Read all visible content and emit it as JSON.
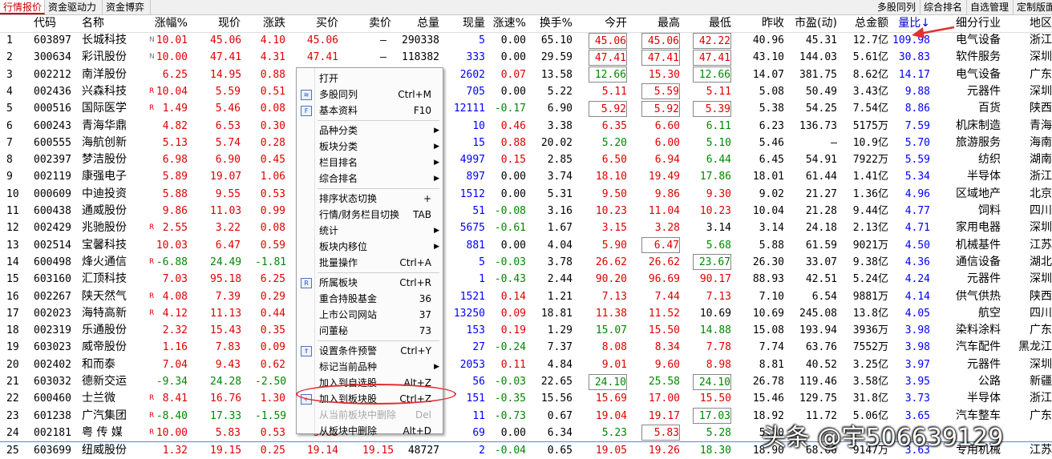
{
  "tabs_left": [
    "行情报价",
    "资金驱动力",
    "资金博弈"
  ],
  "tabs_right": [
    "多股同列",
    "综合排名",
    "自选管理",
    "定制版面"
  ],
  "headers": [
    "代码",
    "名称",
    "涨幅%",
    "现价",
    "涨跌",
    "买价",
    "卖价",
    "总量",
    "现量",
    "涨速%",
    "换手%",
    "今开",
    "最高",
    "最低",
    "昨收",
    "市盈(动)",
    "总金额",
    "量比↓",
    "细分行业",
    "地区"
  ],
  "rows": [
    [
      "1",
      "603897",
      "长城科技",
      "N",
      "10.01",
      "45.06",
      "4.10",
      "45.06",
      "—",
      "290338",
      "5",
      "0.00",
      "65.10",
      "45.06",
      "45.06",
      "42.22",
      "40.96",
      "45.31",
      "12.7亿",
      "109.98",
      "电气设备",
      "浙江"
    ],
    [
      "2",
      "300634",
      "彩讯股份",
      "N",
      "10.00",
      "47.41",
      "4.31",
      "47.41",
      "—",
      "118382",
      "333",
      "0.00",
      "29.59",
      "47.41",
      "47.41",
      "47.41",
      "43.10",
      "144.03",
      "5.61亿",
      "30.83",
      "软件服务",
      "深圳"
    ],
    [
      "3",
      "002212",
      "南洋股份",
      "",
      "6.25",
      "14.95",
      "0.88",
      "",
      "",
      "",
      "2602",
      "0.07",
      "13.58",
      "12.66",
      "15.30",
      "12.66",
      "14.07",
      "381.75",
      "8.62亿",
      "14.17",
      "电气设备",
      "广东"
    ],
    [
      "4",
      "002436",
      "兴森科技",
      "R",
      "10.04",
      "5.59",
      "0.51",
      "",
      "",
      "",
      "705",
      "0.00",
      "5.22",
      "5.11",
      "5.59",
      "5.11",
      "5.08",
      "50.49",
      "3.43亿",
      "9.88",
      "元器件",
      "深圳"
    ],
    [
      "5",
      "000516",
      "国际医学",
      "R",
      "1.49",
      "5.46",
      "0.08",
      "",
      "",
      "",
      "12111",
      "-0.17",
      "6.90",
      "5.92",
      "5.92",
      "5.39",
      "5.38",
      "54.25",
      "7.54亿",
      "8.86",
      "百货",
      "陕西"
    ],
    [
      "6",
      "600243",
      "青海华鼎",
      "",
      "4.82",
      "6.53",
      "0.30",
      "",
      "",
      "",
      "10",
      "0.46",
      "3.38",
      "6.35",
      "6.60",
      "6.11",
      "6.23",
      "136.73",
      "5175万",
      "7.59",
      "机床制造",
      "青海"
    ],
    [
      "7",
      "600555",
      "海航创新",
      "",
      "5.13",
      "5.74",
      "0.28",
      "",
      "",
      "",
      "15",
      "0.88",
      "20.02",
      "5.20",
      "6.00",
      "5.10",
      "5.46",
      "—",
      "10.9亿",
      "5.70",
      "旅游服务",
      "海南"
    ],
    [
      "8",
      "002397",
      "梦洁股份",
      "",
      "6.98",
      "6.90",
      "0.45",
      "",
      "",
      "",
      "4997",
      "0.15",
      "2.85",
      "6.50",
      "6.94",
      "6.44",
      "6.45",
      "54.91",
      "7922万",
      "5.59",
      "纺织",
      "湖南"
    ],
    [
      "9",
      "002119",
      "康强电子",
      "",
      "5.89",
      "19.07",
      "1.06",
      "",
      "",
      "",
      "897",
      "0.00",
      "3.74",
      "18.10",
      "19.49",
      "17.86",
      "18.01",
      "61.44",
      "1.41亿",
      "5.34",
      "半导体",
      "浙江"
    ],
    [
      "10",
      "000609",
      "中迪投资",
      "",
      "5.88",
      "9.55",
      "0.53",
      "",
      "",
      "",
      "1512",
      "0.00",
      "5.31",
      "9.50",
      "9.86",
      "9.30",
      "9.02",
      "21.27",
      "1.36亿",
      "4.96",
      "区域地产",
      "北京"
    ],
    [
      "11",
      "600438",
      "通威股份",
      "",
      "9.86",
      "11.03",
      "0.99",
      "",
      "",
      "",
      "51",
      "-0.08",
      "3.16",
      "10.23",
      "11.04",
      "10.23",
      "10.04",
      "21.28",
      "9.44亿",
      "4.77",
      "饲料",
      "四川"
    ],
    [
      "12",
      "002429",
      "兆驰股份",
      "R",
      "2.55",
      "3.22",
      "0.08",
      "",
      "",
      "",
      "5675",
      "-0.61",
      "1.67",
      "3.15",
      "3.28",
      "3.14",
      "3.14",
      "24.18",
      "2.13亿",
      "4.71",
      "家用电器",
      "深圳"
    ],
    [
      "13",
      "002514",
      "宝馨科技",
      "",
      "10.03",
      "6.47",
      "0.59",
      "",
      "",
      "",
      "881",
      "0.00",
      "4.04",
      "5.90",
      "6.47",
      "5.68",
      "5.88",
      "61.59",
      "9021万",
      "4.50",
      "机械基件",
      "江苏"
    ],
    [
      "14",
      "600498",
      "烽火通信",
      "R",
      "-6.88",
      "24.49",
      "-1.81",
      "",
      "",
      "",
      "5",
      "-0.03",
      "3.78",
      "26.62",
      "26.62",
      "23.67",
      "26.30",
      "33.07",
      "9.38亿",
      "4.36",
      "通信设备",
      "湖北"
    ],
    [
      "15",
      "603160",
      "汇顶科技",
      "",
      "7.03",
      "95.18",
      "6.25",
      "",
      "",
      "",
      "1",
      "-0.43",
      "2.44",
      "90.20",
      "96.69",
      "90.17",
      "88.93",
      "42.51",
      "5.24亿",
      "4.24",
      "元器件",
      "深圳"
    ],
    [
      "16",
      "002267",
      "陕天然气",
      "R",
      "4.08",
      "7.39",
      "0.29",
      "",
      "",
      "",
      "1521",
      "0.14",
      "1.21",
      "7.13",
      "7.44",
      "7.13",
      "7.10",
      "6.54",
      "9881万",
      "4.14",
      "供气供热",
      "陕西"
    ],
    [
      "17",
      "002023",
      "海特高新",
      "R",
      "4.12",
      "11.13",
      "0.44",
      "",
      "",
      "",
      "13250",
      "0.09",
      "18.81",
      "11.38",
      "11.52",
      "10.69",
      "10.69",
      "245.08",
      "13.8亿",
      "4.05",
      "航空",
      "四川"
    ],
    [
      "18",
      "002319",
      "乐通股份",
      "",
      "2.32",
      "15.43",
      "0.35",
      "",
      "",
      "",
      "153",
      "0.19",
      "1.29",
      "15.07",
      "15.50",
      "14.88",
      "15.08",
      "193.94",
      "3936万",
      "3.98",
      "染料涂料",
      "广东"
    ],
    [
      "19",
      "603023",
      "威帝股份",
      "",
      "1.16",
      "7.83",
      "0.09",
      "",
      "",
      "",
      "27",
      "-0.24",
      "7.37",
      "8.08",
      "8.34",
      "7.78",
      "7.74",
      "63.76",
      "7552万",
      "3.98",
      "汽车配件",
      "黑龙江"
    ],
    [
      "20",
      "002402",
      "和而泰",
      "",
      "7.04",
      "9.43",
      "0.62",
      "",
      "",
      "",
      "2053",
      "0.11",
      "4.84",
      "9.01",
      "9.60",
      "8.98",
      "8.81",
      "40.52",
      "3.25亿",
      "3.97",
      "元器件",
      "深圳"
    ],
    [
      "21",
      "603032",
      "德新交运",
      "",
      "-9.34",
      "24.28",
      "-2.50",
      "",
      "",
      "",
      "56",
      "-0.03",
      "22.65",
      "24.10",
      "25.58",
      "24.10",
      "26.78",
      "119.46",
      "3.58亿",
      "3.95",
      "公路",
      "新疆"
    ],
    [
      "22",
      "600460",
      "士兰微",
      "R",
      "8.41",
      "16.76",
      "1.30",
      "",
      "",
      "",
      "151",
      "-0.35",
      "15.56",
      "15.69",
      "17.00",
      "15.50",
      "15.46",
      "129.75",
      "31.8亿",
      "3.73",
      "半导体",
      "浙江"
    ],
    [
      "23",
      "601238",
      "广汽集团",
      "R",
      "-8.40",
      "17.33",
      "-1.59",
      "",
      "",
      "",
      "11",
      "-0.73",
      "0.67",
      "19.04",
      "19.17",
      "17.03",
      "18.92",
      "11.72",
      "5.06亿",
      "3.65",
      "汽车整车",
      "广东"
    ],
    [
      "24",
      "002181",
      "粤 传 媒",
      "R",
      "10.00",
      "5.83",
      "0.53",
      "5.83",
      "",
      "",
      "69",
      "0.00",
      "6.34",
      "5.23",
      "5.83",
      "5.28",
      "5.30",
      "",
      "",
      "",
      "",
      ""
    ],
    [
      "25",
      "603699",
      "纽威股份",
      "",
      "1.32",
      "19.15",
      "0.25",
      "19.14",
      "19.15",
      "48727",
      "2",
      "-0.04",
      "0.65",
      "19.05",
      "19.26",
      "18.30",
      "18.90",
      "68.66",
      "9147万",
      "3.63",
      "专用机械",
      "江苏"
    ]
  ],
  "menu": [
    {
      "label": "打开",
      "shortcut": "",
      "arrow": false,
      "icon": "",
      "disabled": false
    },
    {
      "label": "多股同列",
      "shortcut": "Ctrl+M",
      "arrow": false,
      "icon": "multi-chart-icon",
      "disabled": false
    },
    {
      "label": "基本资料",
      "shortcut": "F10",
      "arrow": false,
      "icon": "f10-icon",
      "disabled": false
    },
    {
      "sep": true
    },
    {
      "label": "品种分类",
      "shortcut": "",
      "arrow": true,
      "icon": "",
      "disabled": false
    },
    {
      "label": "板块分类",
      "shortcut": "",
      "arrow": true,
      "icon": "",
      "disabled": false
    },
    {
      "label": "栏目排名",
      "shortcut": "",
      "arrow": true,
      "icon": "",
      "disabled": false
    },
    {
      "label": "综合排名",
      "shortcut": "",
      "arrow": true,
      "icon": "",
      "disabled": false
    },
    {
      "sep": true
    },
    {
      "label": "排序状态切换",
      "shortcut": "+",
      "arrow": false,
      "icon": "",
      "disabled": false
    },
    {
      "label": "行情/财务栏目切换",
      "shortcut": "TAB",
      "arrow": false,
      "icon": "",
      "disabled": false
    },
    {
      "label": "统计",
      "shortcut": "",
      "arrow": true,
      "icon": "",
      "disabled": false
    },
    {
      "label": "板块内移位",
      "shortcut": "",
      "arrow": true,
      "icon": "",
      "disabled": false
    },
    {
      "label": "批量操作",
      "shortcut": "Ctrl+A",
      "arrow": false,
      "icon": "",
      "disabled": false
    },
    {
      "sep": true
    },
    {
      "label": "所属板块",
      "shortcut": "Ctrl+R",
      "arrow": false,
      "icon": "r-icon",
      "disabled": false
    },
    {
      "label": "重合持股基金",
      "shortcut": "36",
      "arrow": false,
      "icon": "",
      "disabled": false
    },
    {
      "label": "上市公司网站",
      "shortcut": "37",
      "arrow": false,
      "icon": "",
      "disabled": false
    },
    {
      "label": "问董秘",
      "shortcut": "73",
      "arrow": false,
      "icon": "",
      "disabled": false
    },
    {
      "sep": true
    },
    {
      "label": "设置条件预警",
      "shortcut": "Ctrl+Y",
      "arrow": false,
      "icon": "alert-icon",
      "disabled": false
    },
    {
      "label": "标记当前品种",
      "shortcut": "",
      "arrow": true,
      "icon": "",
      "disabled": false
    },
    {
      "label": "加入到自选股",
      "shortcut": "Alt+Z",
      "arrow": false,
      "icon": "",
      "disabled": false
    },
    {
      "label": "加入到板块股",
      "shortcut": "Ctrl+Z",
      "arrow": false,
      "icon": "add-block-icon",
      "disabled": false
    },
    {
      "label": "从当前板块中删除",
      "shortcut": "Del",
      "arrow": false,
      "icon": "",
      "disabled": true
    },
    {
      "label": "从板块中删除",
      "shortcut": "Alt+D",
      "arrow": false,
      "icon": "",
      "disabled": false
    }
  ],
  "watermark": "头条 @宇506639129",
  "colors": {
    "up": "#e00000",
    "down": "#008800",
    "blue": "#0000ff",
    "active_tab": "#c00000",
    "annotation": "#e03030"
  }
}
